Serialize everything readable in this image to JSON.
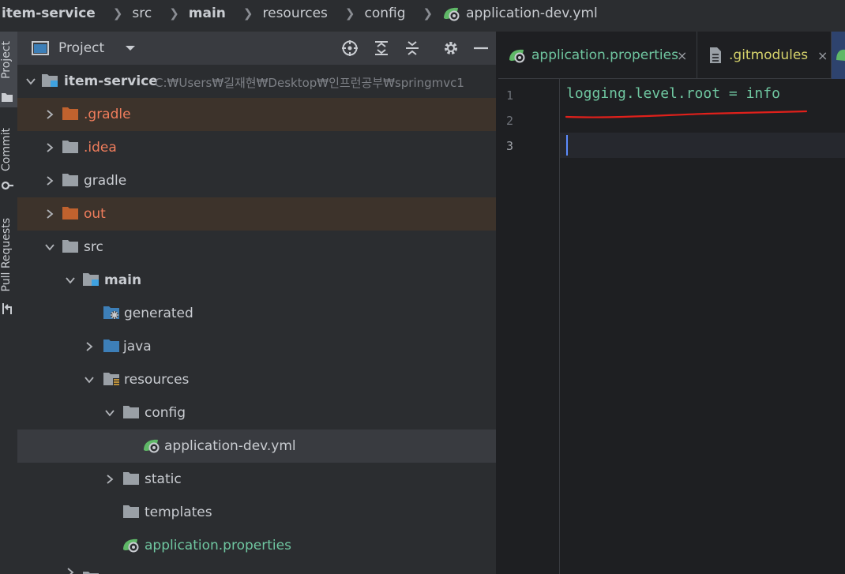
{
  "breadcrumb": {
    "items": [
      {
        "label": "item-service",
        "bold": true
      },
      {
        "label": "src"
      },
      {
        "label": "main",
        "bold": true
      },
      {
        "label": "resources"
      },
      {
        "label": "config"
      },
      {
        "label": "application-dev.yml",
        "icon": "spring-config-icon"
      }
    ]
  },
  "stripe": {
    "project_label": "Project",
    "commit_label": "Commit",
    "pull_requests_label": "Pull Requests"
  },
  "panel": {
    "title": "Project",
    "icons": [
      "locate-icon",
      "expand-all-icon",
      "collapse-all-icon",
      "gear-icon",
      "hide-icon"
    ]
  },
  "tree": {
    "root_label": "item-service",
    "root_path": "C:₩Users₩길재현₩Desktop₩인프런공부₩springmvc1",
    "gradle_hidden": ".gradle",
    "idea": ".idea",
    "gradle": "gradle",
    "out": "out",
    "src": "src",
    "main": "main",
    "generated": "generated",
    "java": "java",
    "resources": "resources",
    "config": "config",
    "application_dev": "application-dev.yml",
    "static": "static",
    "templates": "templates",
    "application_props": "application.properties"
  },
  "editor": {
    "tabs": [
      {
        "label": "application.properties",
        "icon": "spring-config-icon"
      },
      {
        "label": ".gitmodules",
        "icon": "file-icon"
      }
    ],
    "close_glyph": "×",
    "lines": [
      "1",
      "2",
      "3"
    ],
    "code_line_1": "logging.level.root = info",
    "colors": {
      "accent": "#5c8cff",
      "green_text": "#6fc6a0",
      "orange_folder": "#c0622e",
      "underline": "#e0201b"
    }
  }
}
